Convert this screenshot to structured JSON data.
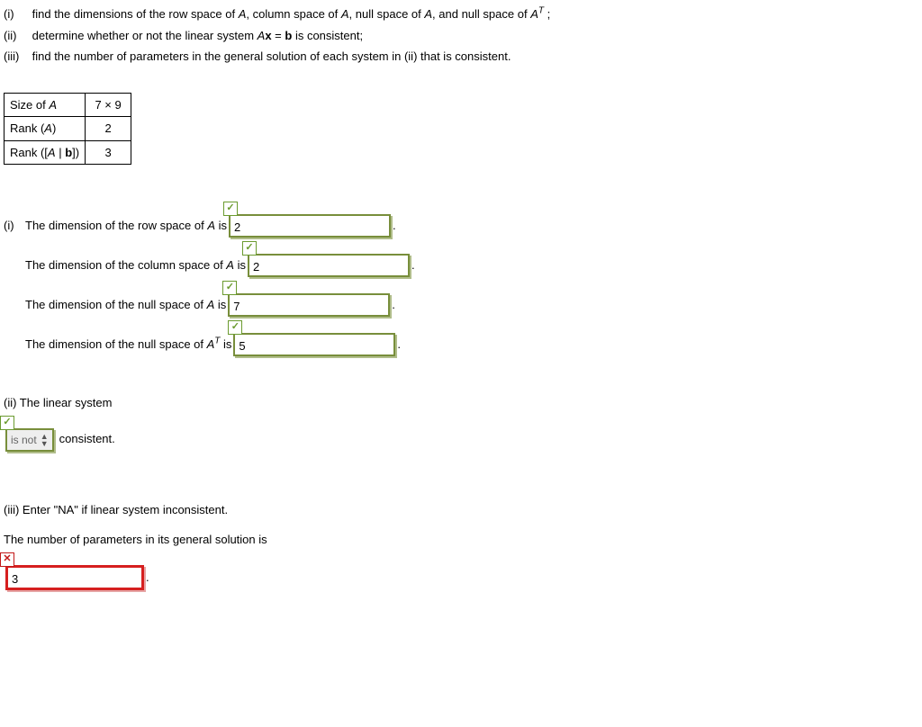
{
  "intro": {
    "i": "find the dimensions of the row space of A, column space of A, null space of A, and null space of Aᵀ ;",
    "ii": "determine whether or not the linear system Ax = b is consistent;",
    "iii": "find the number of parameters in the general solution of each system in (ii) that is consistent."
  },
  "table": {
    "r1": {
      "label": "Size of A",
      "value": "7 × 9"
    },
    "r2": {
      "label": "Rank (A)",
      "value": "2"
    },
    "r3": {
      "label": "Rank ([A | b])",
      "value": "3"
    }
  },
  "part_i": {
    "label": "(i)",
    "row_space": {
      "text_before": "The dimension of the row space of A is",
      "value": "2",
      "period": "."
    },
    "column_space": {
      "text_before": "The dimension of the column space of A is",
      "value": "2",
      "period": "."
    },
    "null_space": {
      "text_before": "The dimension of the null space of A is",
      "value": "7",
      "period": "."
    },
    "null_space_at": {
      "text_before": "The dimension of the null space of Aᵀ is",
      "value": "5",
      "period": "."
    }
  },
  "part_ii": {
    "heading": "(ii) The linear system",
    "select_value": "is not",
    "after": "consistent."
  },
  "part_iii": {
    "heading": "(iii) Enter \"NA\" if linear system inconsistent.",
    "text": "The number of parameters in its general solution is",
    "value": "3",
    "period": "."
  },
  "marks": {
    "check": "✓",
    "cross": "✕"
  }
}
